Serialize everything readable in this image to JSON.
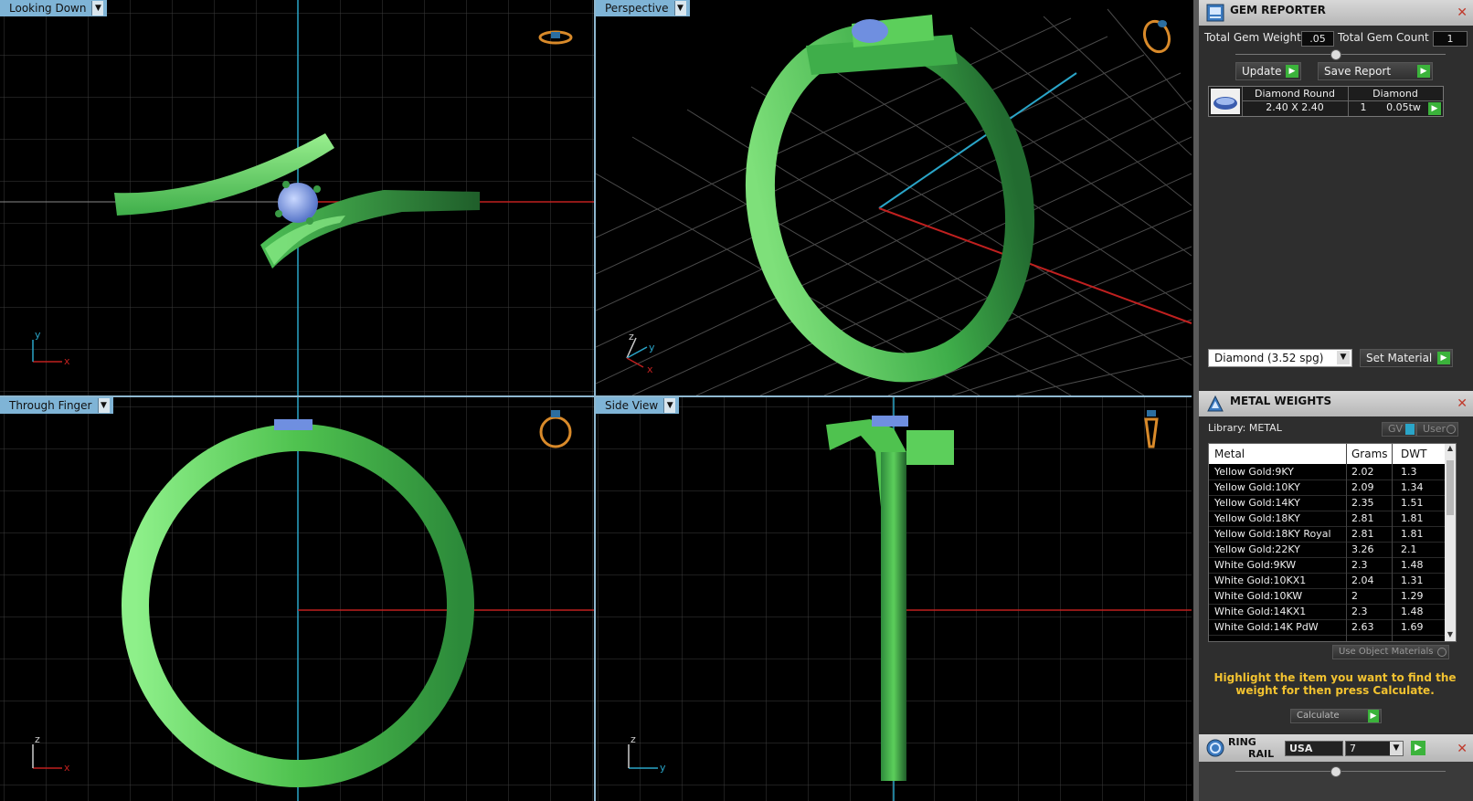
{
  "viewports": {
    "top_left": {
      "label": "Looking Down",
      "axis": [
        "y",
        "x"
      ]
    },
    "top_right": {
      "label": "Perspective",
      "axis": [
        "z",
        "y",
        "x"
      ]
    },
    "bottom_left": {
      "label": "Through Finger",
      "axis": [
        "z",
        "x"
      ]
    },
    "bottom_right": {
      "label": "Side View",
      "axis": [
        "z",
        "y"
      ]
    }
  },
  "gem_reporter": {
    "title": "GEM REPORTER",
    "total_gem_weight_label": "Total Gem Weight",
    "total_gem_weight": ".05",
    "total_gem_count_label": "Total Gem Count",
    "total_gem_count": "1",
    "update_label": "Update",
    "save_report_label": "Save Report",
    "gem": {
      "shape": "Diamond Round",
      "material": "Diamond",
      "size": "2.40 X 2.40",
      "count": "1",
      "weight": "0.05tw"
    },
    "material_select": "Diamond   (3.52 spg)",
    "set_material_label": "Set Material"
  },
  "metal_weights": {
    "title": "METAL WEIGHTS",
    "library_label": "Library: METAL",
    "gv_label": "GV",
    "user_label": "User",
    "columns": [
      "Metal",
      "Grams",
      "DWT"
    ],
    "rows": [
      [
        "Yellow Gold:9KY",
        "2.02",
        "1.3"
      ],
      [
        "Yellow Gold:10KY",
        "2.09",
        "1.34"
      ],
      [
        "Yellow Gold:14KY",
        "2.35",
        "1.51"
      ],
      [
        "Yellow Gold:18KY",
        "2.81",
        "1.81"
      ],
      [
        "Yellow Gold:18KY Royal",
        "2.81",
        "1.81"
      ],
      [
        "Yellow Gold:22KY",
        "3.26",
        "2.1"
      ],
      [
        "White Gold:9KW",
        "2.3",
        "1.48"
      ],
      [
        "White Gold:10KX1",
        "2.04",
        "1.31"
      ],
      [
        "White Gold:10KW",
        "2",
        "1.29"
      ],
      [
        "White Gold:14KX1",
        "2.3",
        "1.48"
      ],
      [
        "White Gold:14K PdW",
        "2.63",
        "1.69"
      ]
    ],
    "use_object_materials_label": "Use Object Materials",
    "hint": "Highlight the item you want to find the weight for then press Calculate.",
    "calculate_label": "Calculate"
  },
  "ring_rail": {
    "title_line1": "RING",
    "title_line2": "RAIL",
    "standard": "USA",
    "size": "7"
  },
  "colors": {
    "ring_light": "#6ee36a",
    "ring_dark": "#2f8f3f",
    "gem": "#7c9ee8",
    "grid": "#3c3c3c",
    "axis_x": "#c0201f",
    "axis_y": "#2aa5c8",
    "tab": "#7fb4d6",
    "accent_green": "#3bb33b",
    "hint_yellow": "#f2c230"
  }
}
